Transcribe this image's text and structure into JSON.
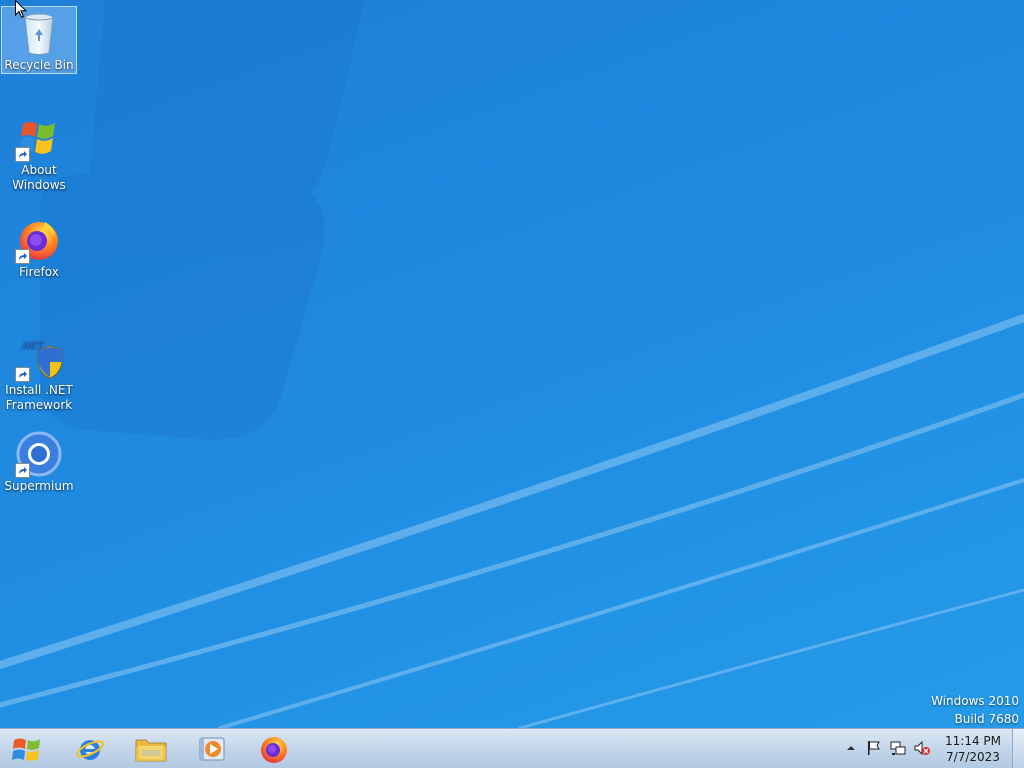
{
  "desktop": {
    "icons": [
      {
        "label": "Recycle Bin",
        "icon": "recycle-bin-icon",
        "selected": true
      },
      {
        "label": "About Windows",
        "icon": "windows-flag-icon",
        "shortcut": true
      },
      {
        "label": "Firefox",
        "icon": "firefox-icon",
        "shortcut": true
      },
      {
        "label": "Install .NET Framework",
        "icon": "dotnet-installer-icon",
        "shortcut": true
      },
      {
        "label": "Supermium",
        "icon": "supermium-icon",
        "shortcut": true
      }
    ],
    "watermark": {
      "line1": "Windows 2010",
      "line2": "Build 7680"
    }
  },
  "taskbar": {
    "start_icon": "windows-orb-icon",
    "pinned": [
      {
        "name": "Internet Explorer",
        "icon": "internet-explorer-icon"
      },
      {
        "name": "File Explorer",
        "icon": "folder-icon"
      },
      {
        "name": "Media Player",
        "icon": "media-player-icon"
      },
      {
        "name": "Firefox",
        "icon": "firefox-icon"
      }
    ],
    "tray": {
      "icons": [
        "show-hidden-icons-icon",
        "action-center-flag-icon",
        "network-icon",
        "volume-muted-icon"
      ],
      "time": "11:14 PM",
      "date": "7/7/2023"
    }
  },
  "colors": {
    "desktop_blue": "#1f8ae0",
    "taskbar": "#c3d6ea"
  }
}
